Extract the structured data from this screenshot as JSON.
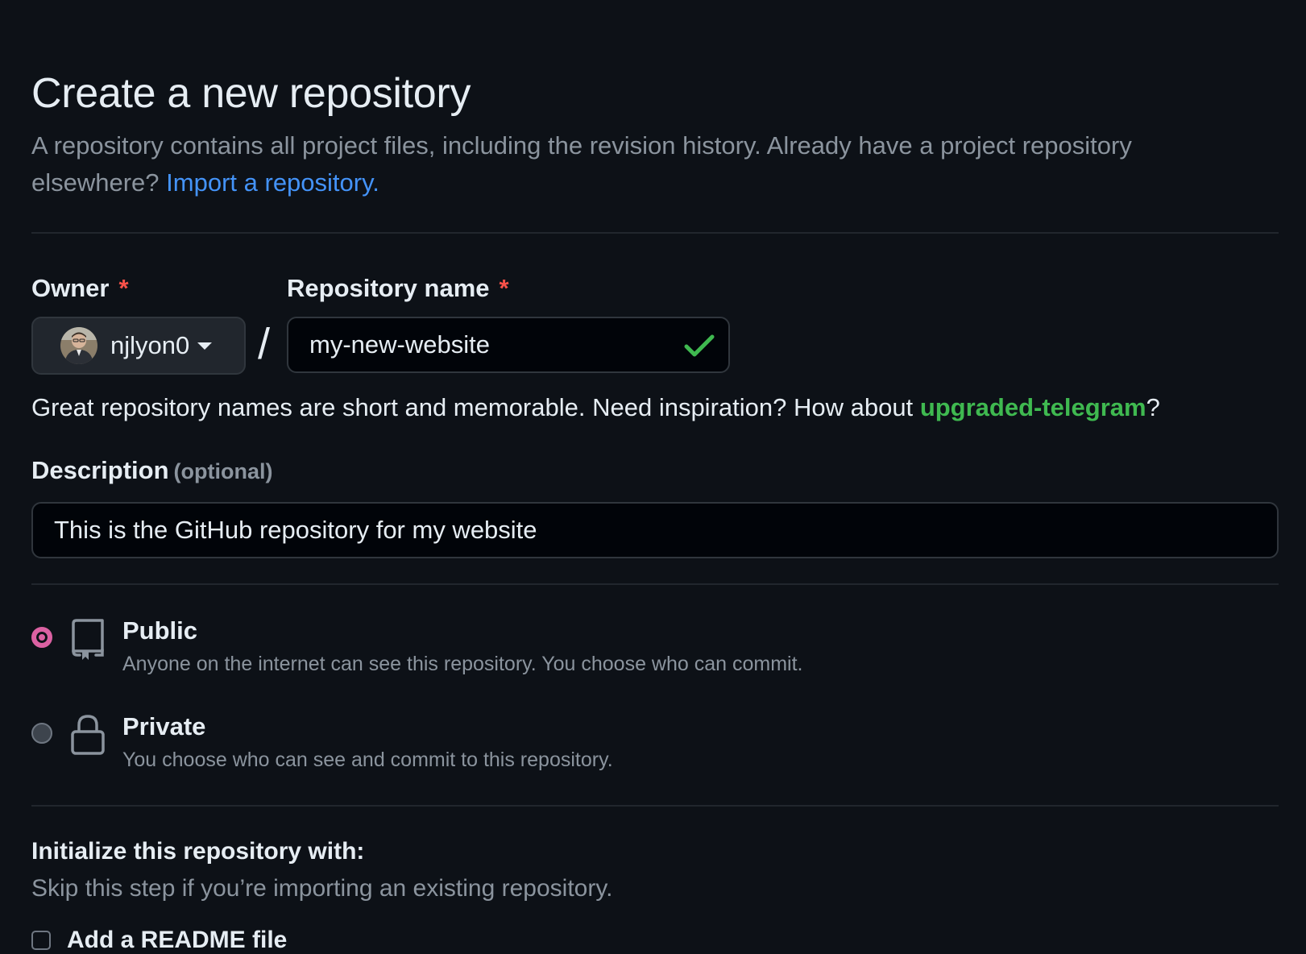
{
  "page": {
    "title": "Create a new repository",
    "subtitle": "A repository contains all project files, including the revision history. Already have a project repository elsewhere?",
    "import_link": "Import a repository."
  },
  "owner": {
    "label": "Owner",
    "required_mark": "*",
    "value": "njlyon0",
    "avatar_icon": "user-avatar",
    "dropdown_icon": "caret-down-icon"
  },
  "separator": "/",
  "repo_name": {
    "label": "Repository name",
    "required_mark": "*",
    "value": "my-new-website",
    "status_icon": "check-icon",
    "status_color": "#3fb950"
  },
  "name_hint": {
    "text": "Great repository names are short and memorable. Need inspiration? How about",
    "suggestion": "upgraded-telegram",
    "suffix": "?"
  },
  "description": {
    "label": "Description",
    "optional": "(optional)",
    "value": "This is the GitHub repository for my website"
  },
  "visibility": {
    "selected": "public",
    "options": [
      {
        "id": "public",
        "title": "Public",
        "desc": "Anyone on the internet can see this repository. You choose who can commit.",
        "icon": "repo-icon"
      },
      {
        "id": "private",
        "title": "Private",
        "desc": "You choose who can see and commit to this repository.",
        "icon": "lock-icon"
      }
    ]
  },
  "initialize": {
    "title": "Initialize this repository with:",
    "subtitle": "Skip this step if you’re importing an existing repository.",
    "readme_label": "Add a README file",
    "readme_checked": false
  },
  "colors": {
    "background": "#0d1117",
    "link": "#4493f8",
    "success": "#3fb950",
    "danger": "#f85149",
    "radio_accent": "#db61a2"
  }
}
